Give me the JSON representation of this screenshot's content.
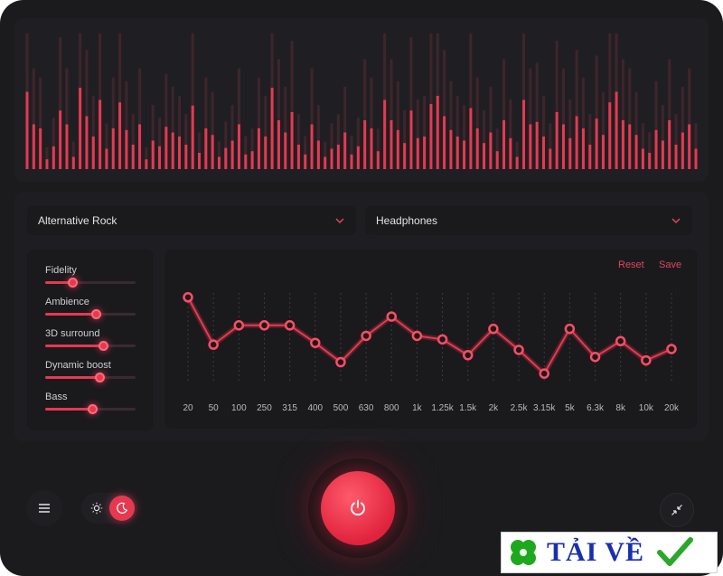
{
  "visualizer": {
    "bar_levels": [
      0.95,
      0.55,
      0.5,
      0.12,
      0.28,
      0.72,
      0.55,
      0.15,
      1.0,
      0.65,
      0.4,
      0.85,
      0.25,
      0.5,
      0.82,
      0.48,
      0.3,
      0.55,
      0.12,
      0.35,
      0.28,
      0.52,
      0.45,
      0.4,
      0.3,
      0.78,
      0.2,
      0.5,
      0.42,
      0.15,
      0.26,
      0.35,
      0.55,
      0.18,
      0.22,
      0.5,
      0.4,
      1.0,
      0.6,
      0.45,
      0.7,
      0.3,
      0.18,
      0.55,
      0.35,
      0.15,
      0.25,
      0.3,
      0.45,
      0.18,
      0.28,
      0.6,
      0.5,
      0.22,
      0.85,
      0.6,
      0.48,
      0.32,
      0.72,
      0.38,
      0.4,
      0.8,
      0.9,
      0.65,
      0.48,
      0.4,
      0.35,
      0.75,
      0.5,
      0.32,
      0.45,
      0.22,
      0.6,
      0.38,
      0.15,
      0.85,
      0.55,
      0.58,
      0.4,
      0.25,
      0.7,
      0.55,
      0.38,
      0.65,
      0.5,
      0.3,
      0.62,
      0.42,
      0.82,
      0.95,
      0.6,
      0.55,
      0.42,
      0.25,
      0.2,
      0.48,
      0.35,
      0.6,
      0.3,
      0.45,
      0.55,
      0.25
    ],
    "accent": "#e63950",
    "dim": "#5a2a32"
  },
  "genre_select": {
    "value": "Alternative Rock"
  },
  "output_select": {
    "value": "Headphones"
  },
  "sliders": [
    {
      "label": "Fidelity",
      "value": 0.3
    },
    {
      "label": "Ambience",
      "value": 0.56
    },
    {
      "label": "3D surround",
      "value": 0.64
    },
    {
      "label": "Dynamic boost",
      "value": 0.6
    },
    {
      "label": "Bass",
      "value": 0.52
    }
  ],
  "equalizer": {
    "reset_label": "Reset",
    "save_label": "Save",
    "bands": [
      "20",
      "50",
      "100",
      "250",
      "315",
      "400",
      "500",
      "630",
      "800",
      "1k",
      "1.25k",
      "1.5k",
      "2k",
      "2.5k",
      "3.15k",
      "5k",
      "6.3k",
      "8k",
      "10k",
      "20k"
    ],
    "levels": [
      0.92,
      0.38,
      0.6,
      0.6,
      0.6,
      0.4,
      0.18,
      0.48,
      0.7,
      0.48,
      0.44,
      0.26,
      0.56,
      0.32,
      0.05,
      0.56,
      0.24,
      0.42,
      0.2,
      0.33
    ]
  },
  "buttons": {
    "menu": "menu-icon",
    "theme_light": "sun-icon",
    "theme_dark": "moon-icon",
    "power": "power-icon",
    "collapse": "collapse-icon"
  },
  "watermark": {
    "text": "TẢI VỀ"
  }
}
